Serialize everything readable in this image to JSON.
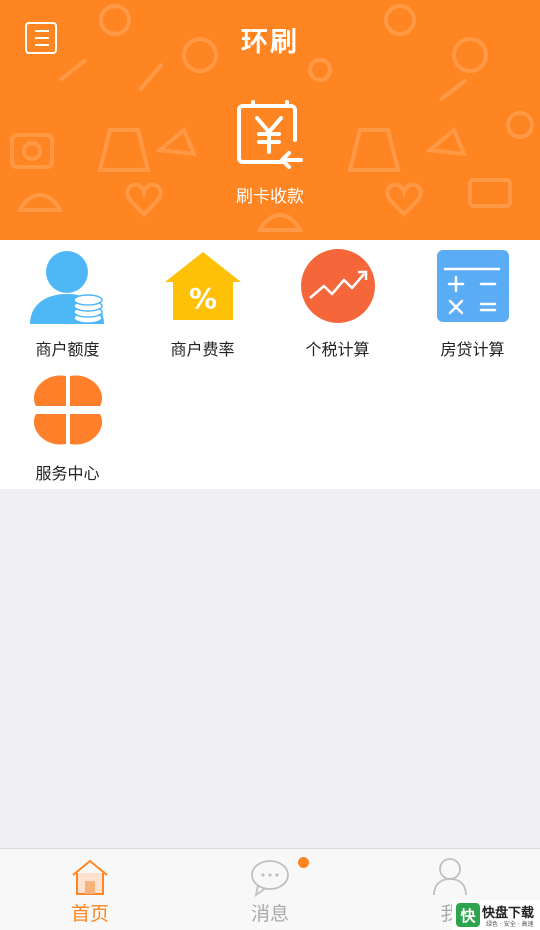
{
  "header": {
    "title": "环刷",
    "menu_icon": "menu-icon",
    "swipe_icon": "card-swipe-yen-icon",
    "swipe_label": "刷卡收款",
    "bg_color": "#ff8522"
  },
  "services": [
    {
      "label": "商户额度",
      "icon": "merchant-limit-icon",
      "color": "#4eb7f5"
    },
    {
      "label": "商户费率",
      "icon": "merchant-rate-icon",
      "color": "#ffc107"
    },
    {
      "label": "个税计算",
      "icon": "tax-calc-icon",
      "color": "#f5673b"
    },
    {
      "label": "房贷计算",
      "icon": "mortgage-calc-icon",
      "color": "#5aacf5"
    },
    {
      "label": "服务中心",
      "icon": "service-center-icon",
      "color": "#ff7f2a"
    }
  ],
  "tabbar": {
    "tabs": [
      {
        "label": "首页",
        "icon": "home-icon",
        "active": true
      },
      {
        "label": "消息",
        "icon": "message-icon",
        "active": false,
        "badge": true
      },
      {
        "label": "我",
        "icon": "profile-icon",
        "active": false
      }
    ],
    "accent": "#ff8522",
    "inactive": "#aaaaaa"
  },
  "watermark": {
    "title": "快盘下载",
    "subtitle": "绿色 · 安全 · 高速",
    "logo_glyph": "快"
  }
}
